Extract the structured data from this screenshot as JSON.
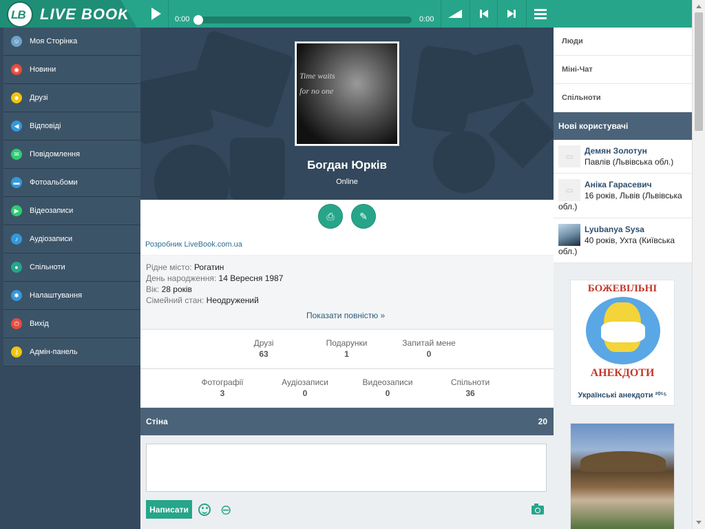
{
  "app": {
    "logo_mark": "LB",
    "logo_text": "LIVE BOOK"
  },
  "player": {
    "time_current": "0:00",
    "time_total": "0:00",
    "progress": 0
  },
  "sidebar": {
    "items": [
      {
        "label": "Моя Сторінка",
        "icon": "user-icon",
        "color": "#6fa2c7"
      },
      {
        "label": "Новини",
        "icon": "broadcast-icon",
        "color": "#e74c3c"
      },
      {
        "label": "Друзі",
        "icon": "smile-icon",
        "color": "#f1c40f"
      },
      {
        "label": "Відповіді",
        "icon": "megaphone-icon",
        "color": "#3498db"
      },
      {
        "label": "Повідомлення",
        "icon": "mail-icon",
        "color": "#2ecc71"
      },
      {
        "label": "Фотоальбоми",
        "icon": "folder-icon",
        "color": "#3498db"
      },
      {
        "label": "Відеозаписи",
        "icon": "play-circle-icon",
        "color": "#2ecc71"
      },
      {
        "label": "Аудіозаписи",
        "icon": "music-note-icon",
        "color": "#3498db"
      },
      {
        "label": "Спільноти",
        "icon": "globe-icon",
        "color": "#27a58a"
      },
      {
        "label": "Налаштування",
        "icon": "gear-icon",
        "color": "#3498db"
      },
      {
        "label": "Вихід",
        "icon": "power-icon",
        "color": "#e74c3c"
      },
      {
        "label": "Адмін-панель",
        "icon": "key-icon",
        "color": "#f1c40f"
      }
    ]
  },
  "profile": {
    "avatar_caption_1": "Time waits",
    "avatar_caption_2": "for no one",
    "name": "Богдан Юрків",
    "status": "Online",
    "about": "Розробник LiveBook.com.ua",
    "info": {
      "hometown_label": "Рідне місто:",
      "hometown": "Рогатин",
      "birthday_label": "День народження:",
      "birthday": "14 Вересня 1987",
      "age_label": "Вік:",
      "age": "28 років",
      "marital_label": "Сімейний стан:",
      "marital": "Неодружений"
    },
    "show_all": "Показати повністю »"
  },
  "stats_row1": [
    {
      "label": "Друзі",
      "value": "63"
    },
    {
      "label": "Подарунки",
      "value": "1"
    },
    {
      "label": "Запитай мене",
      "value": "0"
    }
  ],
  "stats_row2": [
    {
      "label": "Фотографії",
      "value": "3"
    },
    {
      "label": "Аудіозаписи",
      "value": "0"
    },
    {
      "label": "Видеозаписи",
      "value": "0"
    },
    {
      "label": "Спільноти",
      "value": "36"
    }
  ],
  "wall": {
    "title": "Стіна",
    "count": "20",
    "post_button": "Написати"
  },
  "right_nav": [
    "Люди",
    "Міні-Чат",
    "Спільноти"
  ],
  "new_users": {
    "title": "Нові користувачі",
    "users": [
      {
        "name": "Демян Золотун",
        "desc": "Павлів (Львівська обл.)"
      },
      {
        "name": "Аніка Гарасевич",
        "desc": "16 років, Львів (Львівська обл.)"
      },
      {
        "name": "Lyubanya Sysa",
        "desc": "40 років, Ухта (Київська обл.)"
      }
    ]
  },
  "ads": {
    "ad1_title_top": "БОЖЕВІЛЬНІ",
    "ad1_title_bottom": "АНЕКДОТИ",
    "ad1_caption": "Українські анекдоти ²⁰¹⁵"
  }
}
